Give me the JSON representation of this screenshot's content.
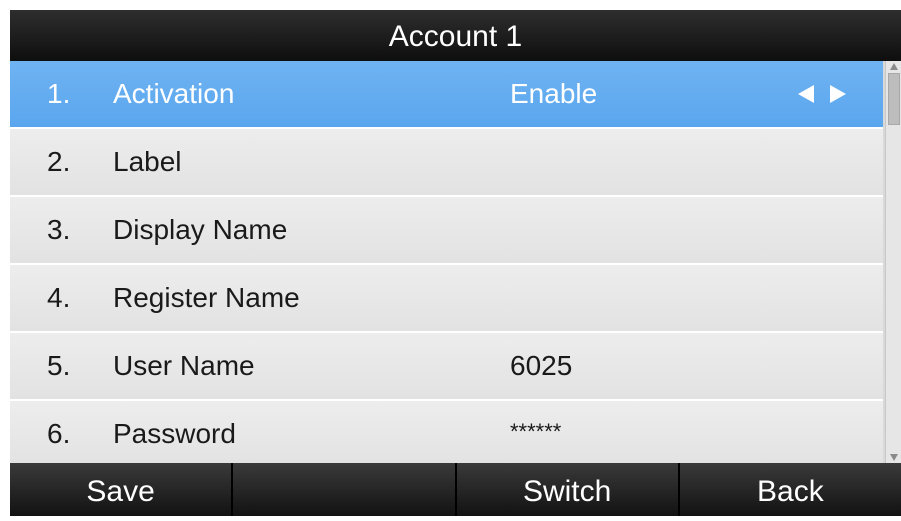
{
  "title": "Account 1",
  "menu": [
    {
      "num": "1.",
      "label": "Activation",
      "value": "Enable",
      "selected": true
    },
    {
      "num": "2.",
      "label": "Label",
      "value": ""
    },
    {
      "num": "3.",
      "label": "Display Name",
      "value": ""
    },
    {
      "num": "4.",
      "label": "Register Name",
      "value": ""
    },
    {
      "num": "5.",
      "label": "User Name",
      "value": "6025"
    },
    {
      "num": "6.",
      "label": "Password",
      "value": "******"
    }
  ],
  "icons": {
    "selector_left": "triangle-left-icon",
    "selector_right": "triangle-right-icon",
    "scroll_up": "scroll-up-arrow-icon",
    "scroll_down": "scroll-down-arrow-icon"
  },
  "softkeys": [
    "Save",
    "",
    "Switch",
    "Back"
  ],
  "colors": {
    "selected_row": "#62acf0",
    "row_bg": "#e8e8e8",
    "bar_bg": "#1e1e1e"
  }
}
